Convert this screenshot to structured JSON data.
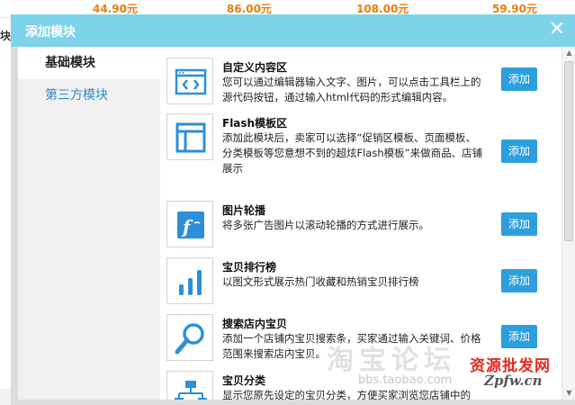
{
  "background": {
    "prices": [
      "44.90元",
      "86.00元",
      "108.00元",
      "59.90元"
    ],
    "left_tab_text": "块"
  },
  "dialog": {
    "title": "添加模块",
    "close_glyph": "✕"
  },
  "nav": {
    "items": [
      {
        "label": "基础模块"
      },
      {
        "label": "第三方模块"
      }
    ]
  },
  "modules": [
    {
      "icon": "code-icon",
      "title": "自定义内容区",
      "desc": "您可以通过编辑器输入文字、图片，可以点击工具栏上的源代码按钮，通过输入html代码的形式编辑内容。",
      "button": "添加"
    },
    {
      "icon": "layout-template-icon",
      "title": "Flash模板区",
      "desc": "添加此模块后，卖家可以选择“促销区模板、页面模板、分类模板等您意想不到的超炫Flash模板”来做商品、店铺展示",
      "button": "添加"
    },
    {
      "icon": "flash-icon",
      "title": "图片轮播",
      "desc": "将多张广告图片以滚动轮播的方式进行展示。",
      "button": "添加"
    },
    {
      "icon": "bar-chart-icon",
      "title": "宝贝排行榜",
      "desc": "以图文形式展示热门收藏和热销宝贝排行榜",
      "button": "添加"
    },
    {
      "icon": "magnifier-icon",
      "title": "搜索店内宝贝",
      "desc": "添加一个店铺内宝贝搜索条，买家通过输入关键词、价格范围来搜索店内宝贝。",
      "button": "添加"
    },
    {
      "icon": "category-tree-icon",
      "title": "宝贝分类",
      "desc": "显示您原先设定的宝贝分类，方便买家浏览您店铺中的",
      "button": ""
    }
  ],
  "watermark": {
    "logo": "资源批发网",
    "url": "Zpfw.cn",
    "big": "淘宝论坛",
    "bbs": "bbs.taobao.com"
  },
  "colors": {
    "header": "#7dd3ea",
    "button": "#2d9fde",
    "icon_blue": "#2d8fd9",
    "price_orange": "#f07c00",
    "nav_link": "#2a8fc7"
  }
}
